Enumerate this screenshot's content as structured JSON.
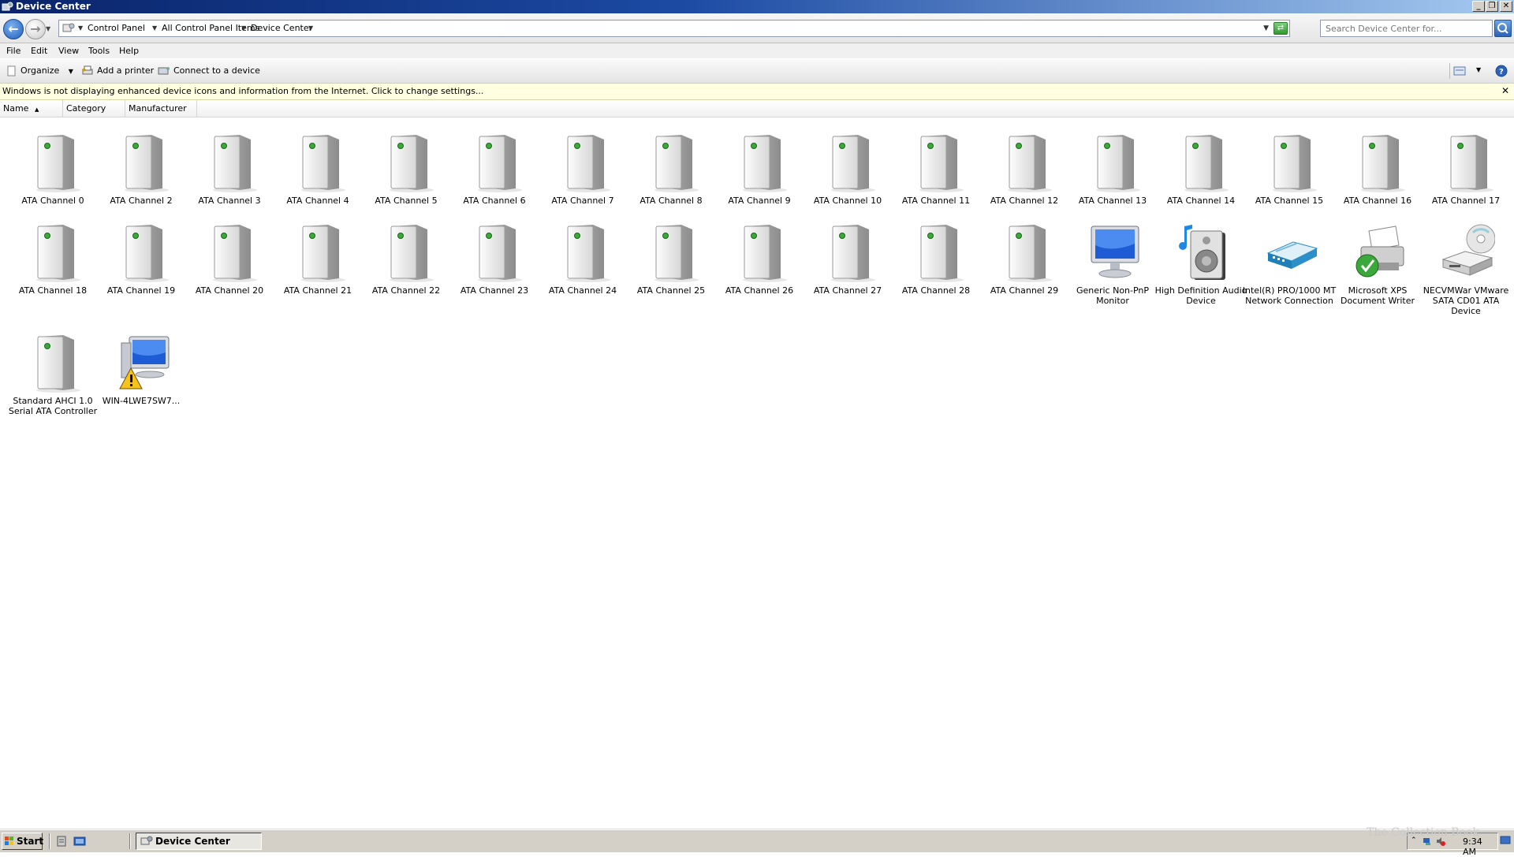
{
  "window": {
    "title": "Device Center"
  },
  "window_controls": {
    "minimize": "_",
    "maximize": "❐",
    "close": "✕"
  },
  "address": {
    "crumbs": [
      "Control Panel",
      "All Control Panel Items",
      "Device Center"
    ],
    "search_placeholder": "Search Device Center for..."
  },
  "menu": {
    "items": [
      "File",
      "Edit",
      "View",
      "Tools",
      "Help"
    ]
  },
  "commands": {
    "organize": "Organize",
    "add_printer": "Add a printer",
    "connect_device": "Connect to a device"
  },
  "infobar": {
    "text": "Windows is not displaying enhanced device icons and information from the Internet.  Click to change settings..."
  },
  "columns": {
    "name": "Name",
    "category": "Category",
    "manufacturer": "Manufacturer"
  },
  "devices": [
    {
      "label": "ATA Channel 0",
      "icon": "drive-icon"
    },
    {
      "label": "ATA Channel 2",
      "icon": "drive-icon"
    },
    {
      "label": "ATA Channel 3",
      "icon": "drive-icon"
    },
    {
      "label": "ATA Channel 4",
      "icon": "drive-icon"
    },
    {
      "label": "ATA Channel 5",
      "icon": "drive-icon"
    },
    {
      "label": "ATA Channel 6",
      "icon": "drive-icon"
    },
    {
      "label": "ATA Channel 7",
      "icon": "drive-icon"
    },
    {
      "label": "ATA Channel 8",
      "icon": "drive-icon"
    },
    {
      "label": "ATA Channel 9",
      "icon": "drive-icon"
    },
    {
      "label": "ATA Channel 10",
      "icon": "drive-icon"
    },
    {
      "label": "ATA Channel 11",
      "icon": "drive-icon"
    },
    {
      "label": "ATA Channel 12",
      "icon": "drive-icon"
    },
    {
      "label": "ATA Channel 13",
      "icon": "drive-icon"
    },
    {
      "label": "ATA Channel 14",
      "icon": "drive-icon"
    },
    {
      "label": "ATA Channel 15",
      "icon": "drive-icon"
    },
    {
      "label": "ATA Channel 16",
      "icon": "drive-icon"
    },
    {
      "label": "ATA Channel 17",
      "icon": "drive-icon"
    },
    {
      "label": "ATA Channel 18",
      "icon": "drive-icon"
    },
    {
      "label": "ATA Channel 19",
      "icon": "drive-icon"
    },
    {
      "label": "ATA Channel 20",
      "icon": "drive-icon"
    },
    {
      "label": "ATA Channel 21",
      "icon": "drive-icon"
    },
    {
      "label": "ATA Channel 22",
      "icon": "drive-icon"
    },
    {
      "label": "ATA Channel 23",
      "icon": "drive-icon"
    },
    {
      "label": "ATA Channel 24",
      "icon": "drive-icon"
    },
    {
      "label": "ATA Channel 25",
      "icon": "drive-icon"
    },
    {
      "label": "ATA Channel 26",
      "icon": "drive-icon"
    },
    {
      "label": "ATA Channel 27",
      "icon": "drive-icon"
    },
    {
      "label": "ATA Channel 28",
      "icon": "drive-icon"
    },
    {
      "label": "ATA Channel 29",
      "icon": "drive-icon"
    },
    {
      "label": "Generic Non-PnP Monitor",
      "icon": "monitor-icon"
    },
    {
      "label": "High Definition Audio Device",
      "icon": "speaker-icon"
    },
    {
      "label": "Intel(R) PRO/1000 MT Network Connection",
      "icon": "network-adapter-icon"
    },
    {
      "label": "Microsoft XPS Document Writer",
      "icon": "printer-icon"
    },
    {
      "label": "NECVMWar VMware SATA CD01 ATA Device",
      "icon": "cd-drive-icon"
    },
    {
      "label": "Standard AHCI 1.0 Serial ATA Controller",
      "icon": "drive-icon"
    },
    {
      "label": "WIN-4LWE7SW7...",
      "icon": "computer-warning-icon"
    }
  ],
  "taskbar": {
    "start_label": "Start",
    "task_label": "Device Center",
    "clock": "9:34 AM"
  },
  "watermark": "The Collection Book",
  "colors": {
    "titlebar": "#0a246a",
    "infobar": "#ffffe1",
    "taskbar": "#d4d0c8"
  }
}
